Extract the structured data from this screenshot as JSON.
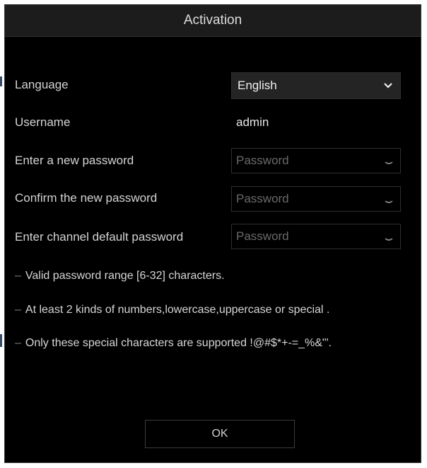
{
  "dialog": {
    "title": "Activation",
    "language": {
      "label": "Language",
      "value": "English"
    },
    "username": {
      "label": "Username",
      "value": "admin"
    },
    "new_password": {
      "label": "Enter a new password",
      "placeholder": "Password"
    },
    "confirm_password": {
      "label": "Confirm the new password",
      "placeholder": "Password"
    },
    "channel_password": {
      "label": "Enter channel default password",
      "placeholder": "Password"
    },
    "notes": [
      "Valid password range [6-32] characters.",
      "At least 2 kinds of numbers,lowercase,uppercase or special .",
      "Only these special characters are supported !@#$*+-=_%&\"'."
    ],
    "ok_label": "OK"
  },
  "icons": {
    "dropdown": "chevron-down-icon",
    "password_visibility": "eye-icon"
  },
  "colors": {
    "background": "#000000",
    "title_bar": "#1c1c1c",
    "text": "#d4d4d4",
    "placeholder": "#6a6a6a"
  }
}
